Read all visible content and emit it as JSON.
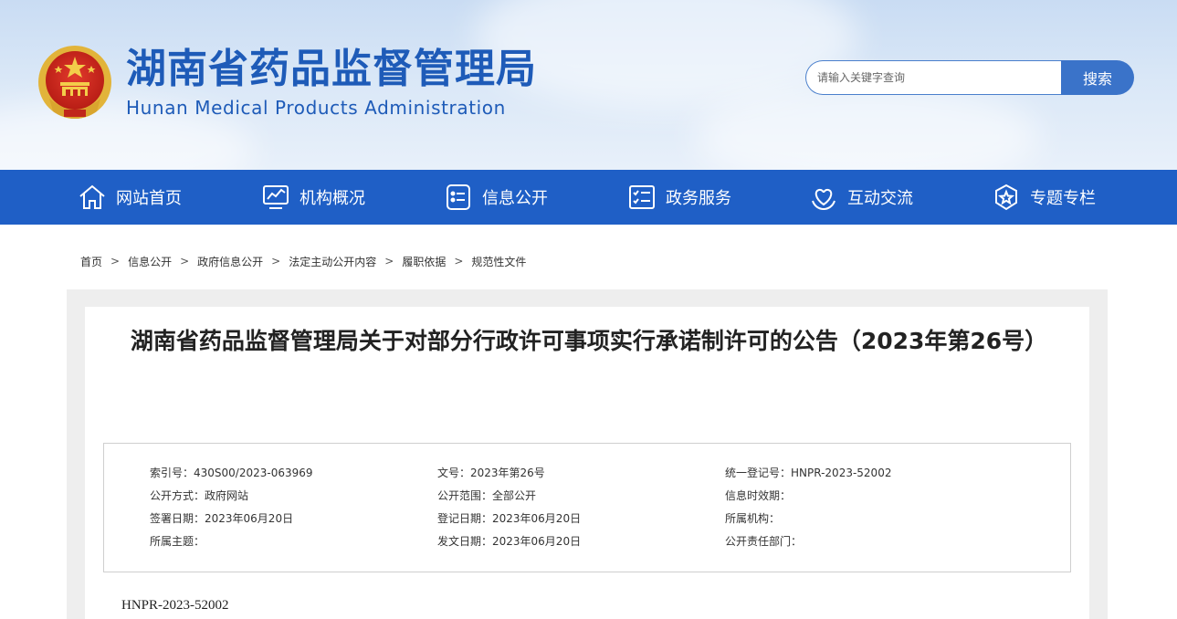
{
  "header": {
    "title_cn": "湖南省药品监督管理局",
    "title_en": "Hunan Medical Products Administration",
    "emblem_icon": "national-emblem-icon"
  },
  "search": {
    "placeholder": "请输入关键字查询",
    "button_label": "搜索"
  },
  "nav": {
    "items": [
      {
        "label": "网站首页",
        "icon": "home-icon"
      },
      {
        "label": "机构概况",
        "icon": "chart-monitor-icon"
      },
      {
        "label": "信息公开",
        "icon": "document-list-icon"
      },
      {
        "label": "政务服务",
        "icon": "checklist-icon"
      },
      {
        "label": "互动交流",
        "icon": "heart-hand-icon"
      },
      {
        "label": "专题专栏",
        "icon": "star-shield-icon"
      }
    ]
  },
  "breadcrumb": {
    "separator": ">",
    "items": [
      "首页",
      "信息公开",
      "政府信息公开",
      "法定主动公开内容",
      "履职依据",
      "规范性文件"
    ]
  },
  "article": {
    "title": "湖南省药品监督管理局关于对部分行政许可事项实行承诺制许可的公告（2023年第26号）",
    "doc_code": "HNPR-2023-52002"
  },
  "meta": {
    "index_no": "索引号：430S00/2023-063969",
    "doc_no": "文号：2023年第26号",
    "unified_reg_no": "统一登记号：HNPR-2023-52002",
    "publish_method": "公开方式：政府网站",
    "publish_scope": "公开范围：全部公开",
    "validity": "信息时效期：",
    "sign_date": "签署日期：2023年06月20日",
    "reg_date": "登记日期：2023年06月20日",
    "org": "所属机构：",
    "topic": "所属主题：",
    "issue_date": "发文日期：2023年06月20日",
    "dept": "公开责任部门："
  },
  "colors": {
    "brand_blue": "#1f5fc6",
    "title_blue": "#1e5bb8",
    "search_button": "#3a73c9"
  }
}
